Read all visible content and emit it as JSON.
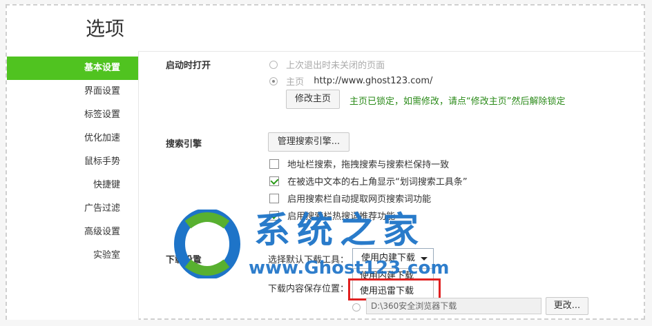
{
  "header": {
    "title": "选项"
  },
  "sidebar": {
    "items": [
      {
        "label": "基本设置",
        "active": true
      },
      {
        "label": "界面设置"
      },
      {
        "label": "标签设置"
      },
      {
        "label": "优化加速"
      },
      {
        "label": "鼠标手势"
      },
      {
        "label": "快捷键"
      },
      {
        "label": "广告过滤"
      },
      {
        "label": "高级设置"
      },
      {
        "label": "实验室"
      }
    ]
  },
  "startup": {
    "title": "启动时打开",
    "option1": "上次退出时未关闭的页面",
    "option2_label": "主页",
    "option2_url": "http://www.ghost123.com/",
    "modify_button": "修改主页",
    "lock_note": "主页已锁定，如需修改，请点“修改主页”然后解除锁定"
  },
  "search": {
    "title": "搜索引擎",
    "manage_button": "管理搜索引擎...",
    "options": [
      {
        "label": "地址栏搜索，拖拽搜索与搜索栏保持一致",
        "checked": false
      },
      {
        "label": "在被选中文本的右上角显示“划词搜索工具条”",
        "checked": true
      },
      {
        "label": "启用搜索栏自动提取网页搜索词功能",
        "checked": false
      },
      {
        "label": "启用搜索栏热搜词推荐功能",
        "checked": true
      }
    ]
  },
  "download": {
    "title": "下载设置",
    "tool_label": "选择默认下载工具：",
    "tool_selected": "使用内建下载",
    "dropdown_options": [
      "使用内建下载",
      "使用迅雷下载"
    ],
    "save_label": "下载内容保存位置：",
    "path": "D:\\360安全浏览器下载",
    "change_button": "更改..."
  },
  "watermark": {
    "text": "系统之家",
    "url": "www.Ghost123.com"
  },
  "colors": {
    "accent": "#50c320",
    "watermark": "#1e74c8",
    "highlight": "#e02020"
  }
}
